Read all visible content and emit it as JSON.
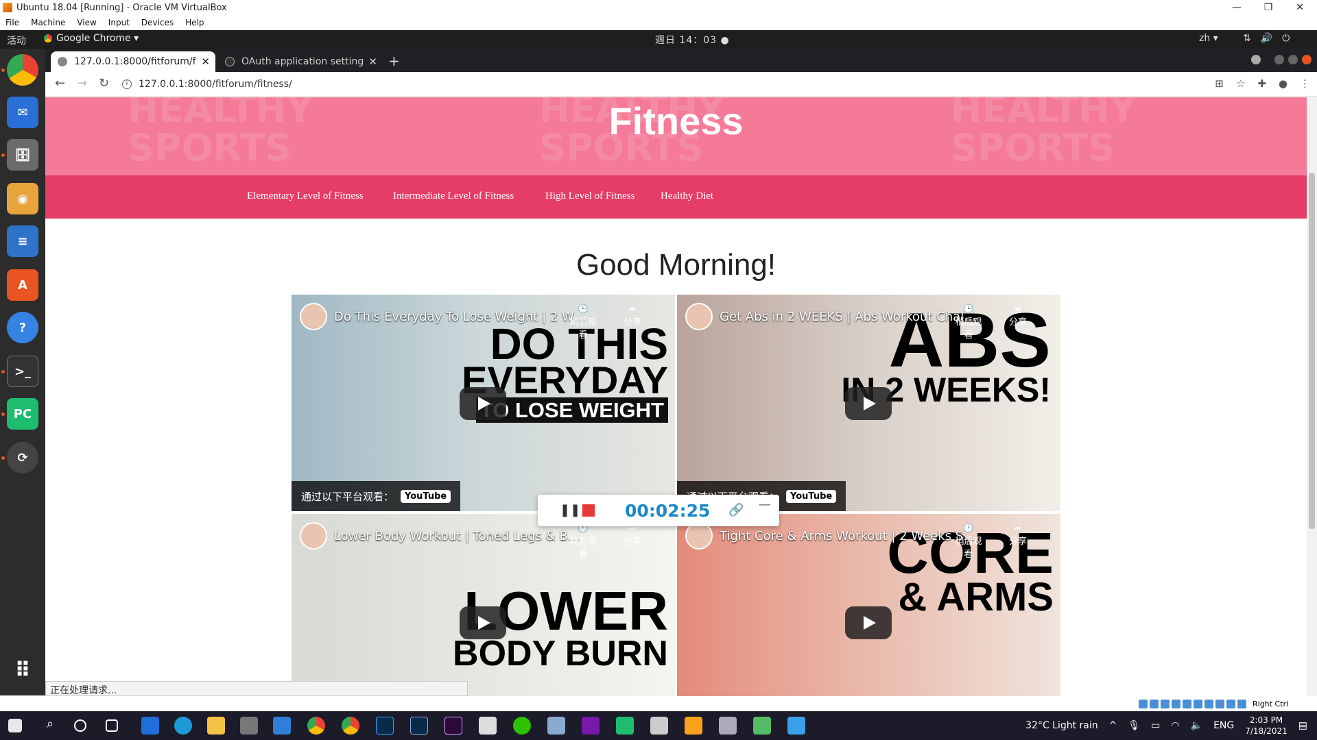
{
  "vbox": {
    "title": "Ubuntu 18.04 [Running] - Oracle VM VirtualBox",
    "menu": [
      "File",
      "Machine",
      "View",
      "Input",
      "Devices",
      "Help"
    ],
    "status_label": "Right Ctrl"
  },
  "gnome": {
    "activities": "活动",
    "app_menu": "Google Chrome ▾",
    "clock": "週日 14：03 ●",
    "lang": "zh ▾"
  },
  "chrome": {
    "tabs": [
      {
        "label": "127.0.0.1:8000/fitforum/f",
        "active": true
      },
      {
        "label": "OAuth application setting",
        "active": false
      }
    ],
    "url": "127.0.0.1:8000/fitforum/fitness/",
    "status": "正在处理请求..."
  },
  "page": {
    "hero_title": "Fitness",
    "hero_bg_text": "HEALTHY SPORTS",
    "nav": [
      "Elementary Level of Fitness",
      "Intermediate Level of Fitness",
      "High Level of Fitness",
      "Healthy Diet"
    ],
    "greeting": "Good Morning!",
    "videos": [
      {
        "title": "Do This Everyday To Lose Weight | 2 W…",
        "big": [
          "DO THIS",
          "EVERYDAY",
          "TO LOSE WEIGHT"
        ],
        "watch_label": "通过以下平台观看：",
        "yt": "YouTube",
        "later": "稍后观看",
        "share": "分享"
      },
      {
        "title": "Get Abs in 2 WEEKS | Abs Workout Chal…",
        "big": [
          "ABS",
          "IN 2 WEEKS!"
        ],
        "watch_label": "通过以下平台观看：",
        "yt": "YouTube",
        "later": "稍后观看",
        "share": "分享"
      },
      {
        "title": "Lower Body Workout | Toned Legs & B…",
        "big": [
          "LOWER",
          "BODY BURN"
        ],
        "later": "稍后观看",
        "share": "分享"
      },
      {
        "title": "Tight Core & Arms Workout | 2 Weeks S…",
        "big": [
          "CORE",
          "& ARMS"
        ],
        "later": "稍后观看",
        "share": "分享"
      }
    ]
  },
  "recorder": {
    "time": "00:02:25"
  },
  "taskbar": {
    "weather": "32°C  Light rain",
    "lang": "ENG",
    "time": "2:03 PM",
    "date": "7/18/2021"
  },
  "colors": {
    "hero": "#f47a98",
    "nav": "#e63d67",
    "recorder_time": "#1a88c9"
  }
}
